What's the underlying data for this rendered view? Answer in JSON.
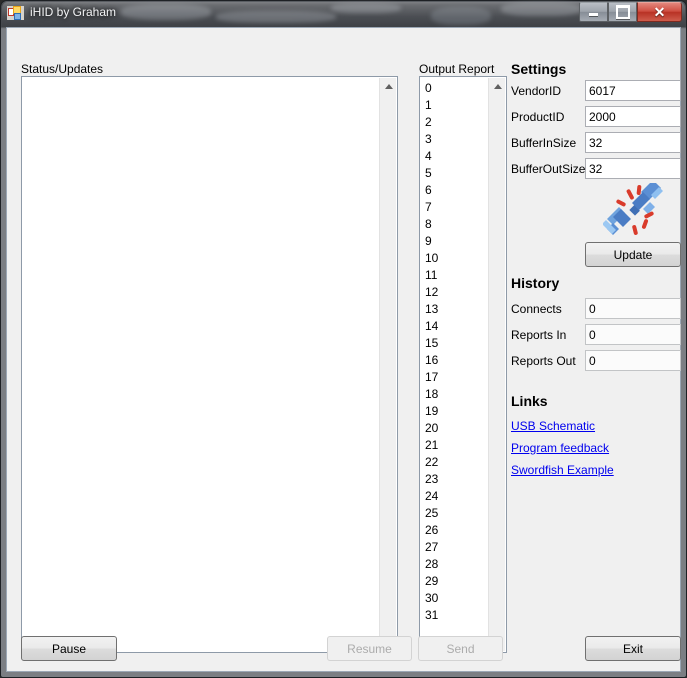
{
  "window": {
    "title": "iHID by Graham",
    "app_icon": "winforms-app-icon",
    "controls": {
      "minimize": "Minimize",
      "maximize": "Maximize",
      "close": "Close",
      "close_glyph": "✕",
      "close_color": "#c0392b"
    }
  },
  "status_panel": {
    "label": "Status/Updates",
    "content": "",
    "scroll_up": "scroll-up-arrow",
    "scroll_down": "scroll-down-arrow"
  },
  "output_report": {
    "label": "Output Report",
    "items": [
      "0",
      "1",
      "2",
      "3",
      "4",
      "5",
      "6",
      "7",
      "8",
      "9",
      "10",
      "11",
      "12",
      "13",
      "14",
      "15",
      "16",
      "17",
      "18",
      "19",
      "20",
      "21",
      "22",
      "23",
      "24",
      "25",
      "26",
      "27",
      "28",
      "29",
      "30",
      "31"
    ],
    "scroll_up": "scroll-up-arrow",
    "scroll_down": "scroll-down-arrow"
  },
  "settings": {
    "heading": "Settings",
    "fields": [
      {
        "label": "VendorID",
        "value": "6017"
      },
      {
        "label": "ProductID",
        "value": "2000"
      },
      {
        "label": "BufferInSize",
        "value": "32"
      },
      {
        "label": "BufferOutSize",
        "value": "32"
      }
    ],
    "icon": "usb-connector-plug-icon",
    "update_button": "Update"
  },
  "history": {
    "heading": "History",
    "rows": [
      {
        "label": "Connects",
        "value": "0"
      },
      {
        "label": "Reports In",
        "value": "0"
      },
      {
        "label": "Reports Out",
        "value": "0"
      }
    ]
  },
  "links": {
    "heading": "Links",
    "items": [
      {
        "label": "USB Schematic"
      },
      {
        "label": "Program feedback"
      },
      {
        "label": "Swordfish Example"
      }
    ],
    "color": "#0000ee"
  },
  "footer": {
    "buttons": [
      {
        "label": "Pause",
        "enabled": true
      },
      {
        "label": "Resume",
        "enabled": false
      },
      {
        "label": "Send",
        "enabled": false
      },
      {
        "label": "Exit",
        "enabled": true
      }
    ]
  }
}
